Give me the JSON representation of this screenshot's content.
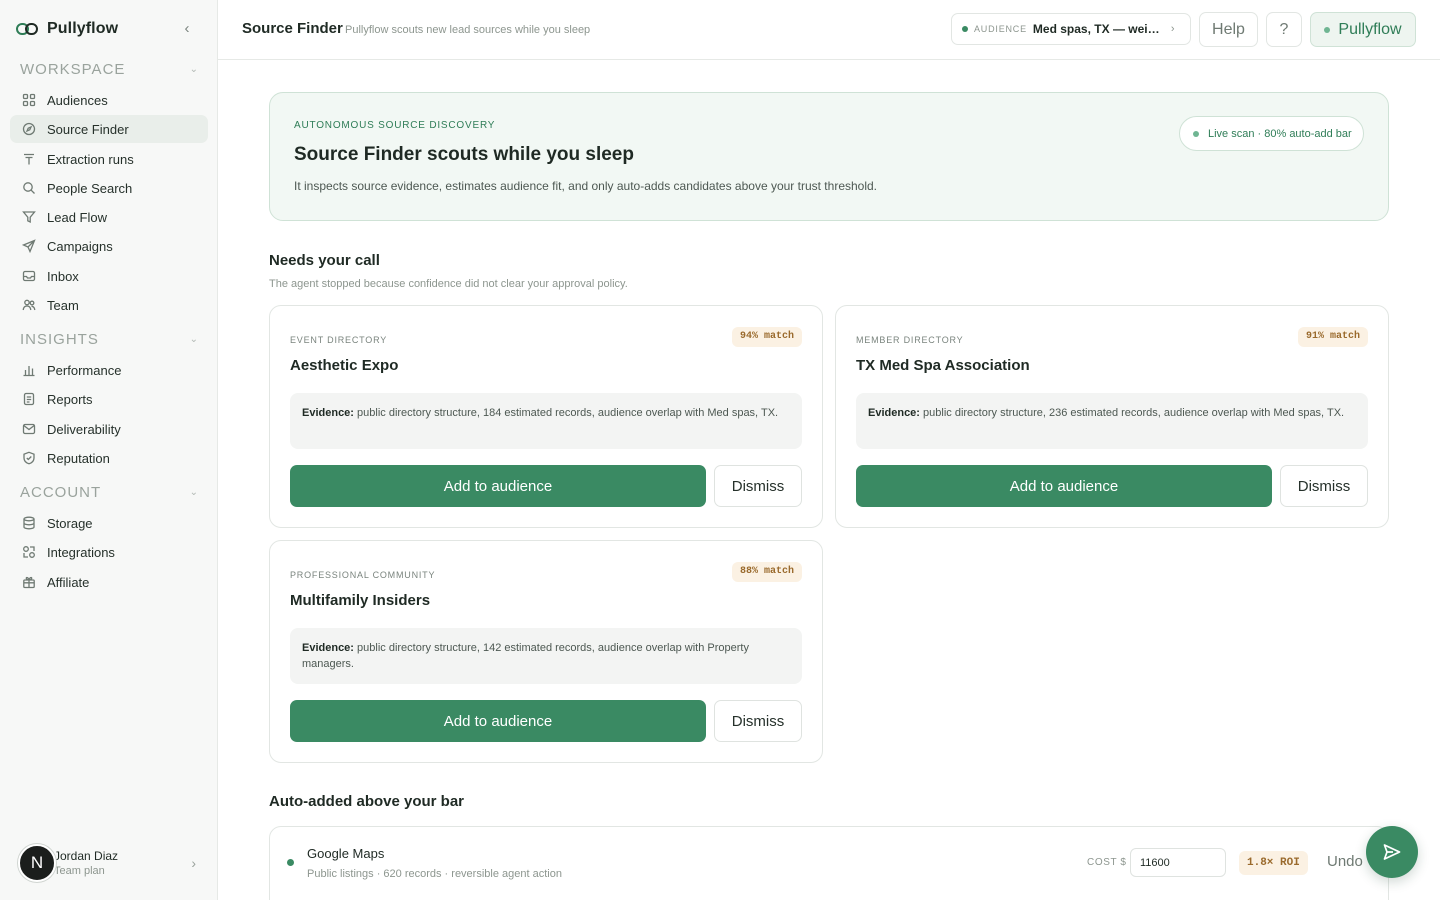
{
  "brand": {
    "name": "Pullyflow"
  },
  "sidebar": {
    "sections": [
      {
        "title": "WORKSPACE",
        "items": [
          {
            "label": "Audiences",
            "icon": "grid-icon"
          },
          {
            "label": "Source Finder",
            "icon": "compass-icon",
            "active": true
          },
          {
            "label": "Extraction runs",
            "icon": "runs-icon"
          },
          {
            "label": "People Search",
            "icon": "search-icon"
          },
          {
            "label": "Lead Flow",
            "icon": "filter-icon"
          },
          {
            "label": "Campaigns",
            "icon": "send-icon"
          },
          {
            "label": "Inbox",
            "icon": "inbox-icon"
          },
          {
            "label": "Team",
            "icon": "team-icon"
          }
        ]
      },
      {
        "title": "INSIGHTS",
        "items": [
          {
            "label": "Performance",
            "icon": "bar-chart-icon"
          },
          {
            "label": "Reports",
            "icon": "document-icon"
          },
          {
            "label": "Deliverability",
            "icon": "mail-icon"
          },
          {
            "label": "Reputation",
            "icon": "shield-icon"
          }
        ]
      },
      {
        "title": "ACCOUNT",
        "items": [
          {
            "label": "Storage",
            "icon": "database-icon"
          },
          {
            "label": "Integrations",
            "icon": "integrations-icon"
          },
          {
            "label": "Affiliate",
            "icon": "gift-icon"
          }
        ]
      }
    ],
    "user": {
      "initial": "N",
      "name": "Jordan Diaz",
      "plan": "Team plan"
    }
  },
  "header": {
    "title": "Source Finder",
    "subtitle": "Pullyflow scouts new lead sources while you sleep",
    "audience_key": "AUDIENCE",
    "audience_value": "Med spas, TX — weighted",
    "help_label": "Help",
    "question_label": "?",
    "brand_label": "Pullyflow"
  },
  "hero": {
    "eyebrow": "AUTONOMOUS SOURCE DISCOVERY",
    "title": "Source Finder scouts while you sleep",
    "description": "It inspects source evidence, estimates audience fit, and only auto-adds candidates above your trust threshold.",
    "live_label": "Live scan · 80% auto-add bar"
  },
  "needs_call": {
    "title": "Needs your call",
    "subtitle": "The agent stopped because confidence did not clear your approval policy.",
    "add_label": "Add to audience",
    "dismiss_label": "Dismiss",
    "evidence_label": "Evidence:",
    "cards": [
      {
        "kind": "EVENT DIRECTORY",
        "name": "Aesthetic Expo",
        "match": "94% match",
        "evidence": "public directory structure, 184 estimated records, audience overlap with Med spas, TX."
      },
      {
        "kind": "MEMBER DIRECTORY",
        "name": "TX Med Spa Association",
        "match": "91% match",
        "evidence": "public directory structure, 236 estimated records, audience overlap with Med spas, TX."
      },
      {
        "kind": "PROFESSIONAL COMMUNITY",
        "name": "Multifamily Insiders",
        "match": "88% match",
        "evidence": "public directory structure, 142 estimated records, audience overlap with Property managers."
      }
    ]
  },
  "auto_added": {
    "title": "Auto-added above your bar",
    "rows": [
      {
        "name": "Google Maps",
        "meta": "Public listings · 620 records · reversible agent action",
        "cost_label": "COST $",
        "cost_value": "11600",
        "roi": "1.8× ROI",
        "undo_label": "Undo"
      }
    ]
  },
  "colors": {
    "accent": "#3a8a63",
    "badge_bg": "#fbf1e3",
    "badge_text": "#9a6a2c"
  }
}
